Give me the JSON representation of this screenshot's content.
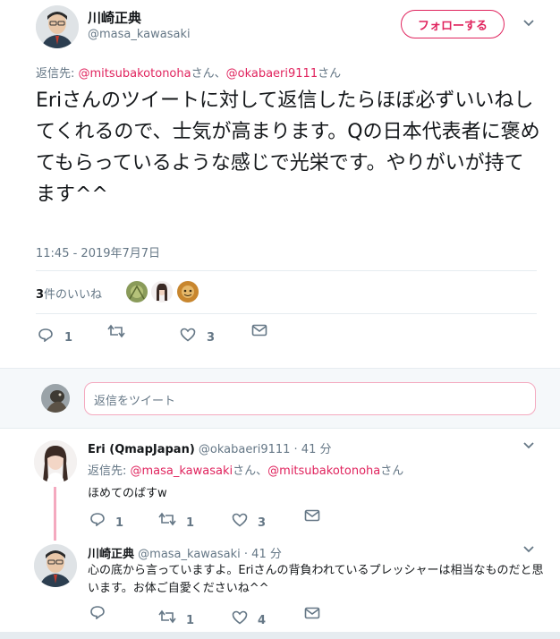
{
  "tweet": {
    "author_name": "川崎正典",
    "author_handle": "@masa_kawasaki",
    "follow_label": "フォローする",
    "reply_to_prefix": "返信先: ",
    "reply_to_1": "@mitsubakotonoha",
    "reply_to_sep": "さん、",
    "reply_to_2": "@okabaeri9111",
    "reply_to_suffix": "さん",
    "text": "Eriさんのツイートに対して返信したらほぼ必ずいいねしてくれるので、士気が高まります。Qの日本代表者に褒めてもらっているような感じで光栄です。やりがいが持てます^^",
    "timestamp": "11:45 - 2019年7月7日",
    "likes_count": "3",
    "likes_label": "件のいいね",
    "replies": "1",
    "retweets": "",
    "likes": "3"
  },
  "reply_box": {
    "placeholder": "返信をツイート"
  },
  "reply1": {
    "author_name": "Eri (QmapJapan)",
    "author_handle": "@okabaeri9111",
    "time": "· 41 分",
    "reply_to_prefix": "返信先: ",
    "reply_to_1": "@masa_kawasaki",
    "reply_to_sep": "さん、",
    "reply_to_2": "@mitsubakotonoha",
    "reply_to_suffix": "さん",
    "text": "ほめてのばすw",
    "replies": "1",
    "retweets": "1",
    "likes": "3"
  },
  "reply2": {
    "author_name": "川崎正典",
    "author_handle": "@masa_kawasaki",
    "time": "· 41 分",
    "text": "心の底から言っていますよ。Eriさんの背負われているプレッシャーは相当なものだと思います。お体ご自愛くださいね^^",
    "replies": "",
    "retweets": "1",
    "likes": "4"
  },
  "colors": {
    "accent": "#e0245e",
    "muted": "#657786",
    "border": "#e6ecf0"
  }
}
